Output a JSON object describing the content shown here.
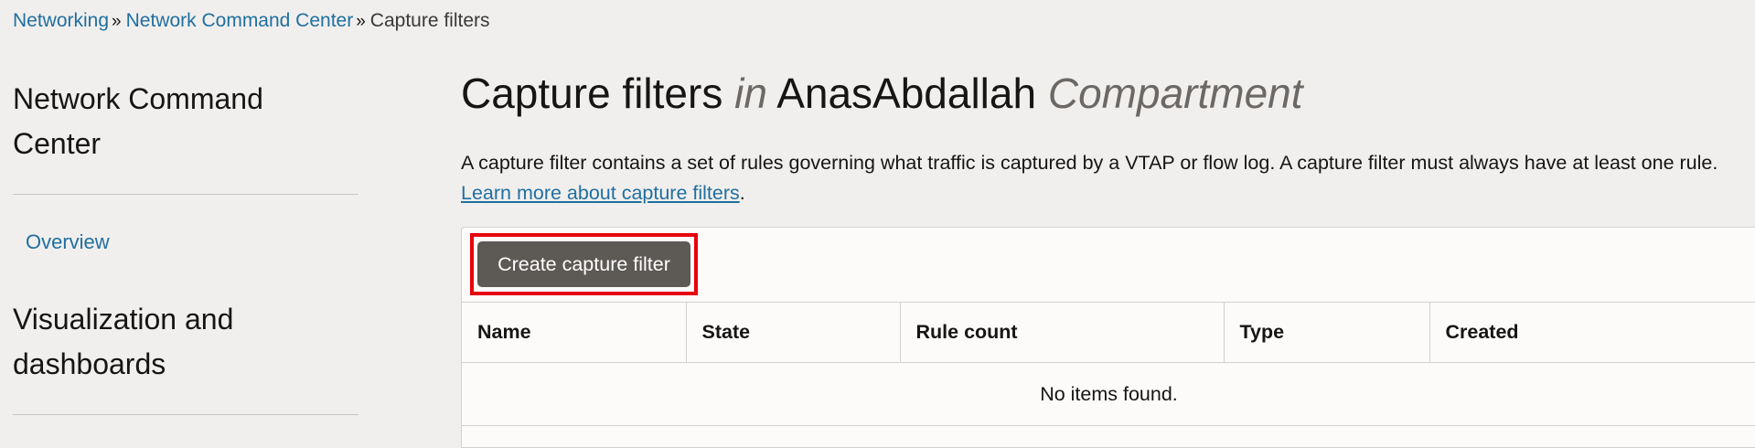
{
  "breadcrumb": {
    "items": [
      "Networking",
      "Network Command Center"
    ],
    "separator": "»",
    "current": "Capture filters"
  },
  "sidebar": {
    "section1_title": "Network Command Center",
    "overview_link": "Overview",
    "section2_title": "Visualization and dashboards"
  },
  "header": {
    "title_main": "Capture filters",
    "title_in": "in",
    "compartment_name": "AnasAbdallah",
    "compartment_word": "Compartment"
  },
  "description": {
    "text": "A capture filter contains a set of rules governing what traffic is captured by a VTAP or flow log. A capture filter must always have at least one rule.",
    "link": "Learn more about capture filters",
    "end": "."
  },
  "toolbar": {
    "create_label": "Create capture filter"
  },
  "table": {
    "columns": [
      "Name",
      "State",
      "Rule count",
      "Type",
      "Created"
    ],
    "empty_message": "No items found."
  },
  "colors": {
    "link": "#1f6fa0",
    "primary_button": "#5d5955",
    "highlight": "#e8000b",
    "background": "#f1efed"
  }
}
